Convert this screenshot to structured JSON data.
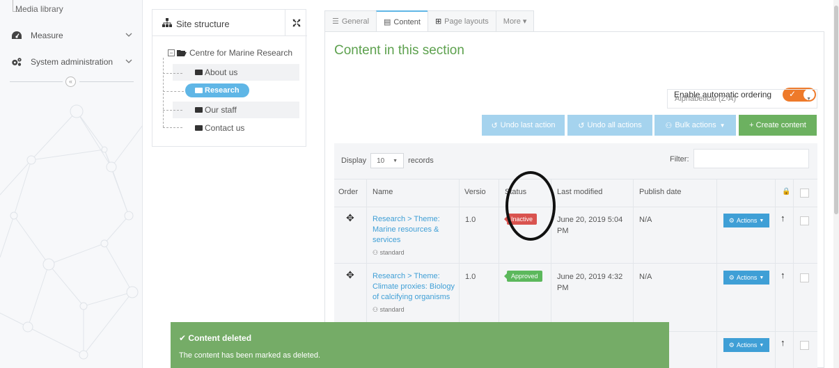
{
  "sidebar": {
    "media_library": "Media library",
    "items": [
      {
        "label": "Measure",
        "icon": "dashboard-icon"
      },
      {
        "label": "System administration",
        "icon": "gears-icon"
      }
    ],
    "collapse_glyph": "«"
  },
  "site_structure": {
    "title": "Site structure",
    "root": "Centre for Marine Research",
    "nodes": [
      "About us",
      "Research",
      "Our staff",
      "Contact us"
    ],
    "selected": "Research"
  },
  "tabs": [
    {
      "label": "General",
      "icon": "sliders-icon"
    },
    {
      "label": "Content",
      "icon": "document-icon"
    },
    {
      "label": "Page layouts",
      "icon": "layout-icon"
    },
    {
      "label": "More ▾",
      "icon": ""
    }
  ],
  "content": {
    "title": "Content in this section",
    "auto_ordering_label": "Enable automatic ordering",
    "auto_ordering_enabled": true,
    "order_select": "Alphabetical (Z-A)",
    "buttons": {
      "undo_last": "Undo last action",
      "undo_all": "Undo all actions",
      "bulk": "Bulk actions",
      "create": "+ Create content"
    },
    "display_label": "Display",
    "display_value": "10",
    "records_label": "records",
    "filter_label": "Filter:",
    "filter_value": "",
    "columns": [
      "Order",
      "Name",
      "Versio",
      "Status",
      "Last modified",
      "Publish date"
    ],
    "rows": [
      {
        "name": "Research > Theme: Marine resources & services",
        "type": "standard",
        "version": "1.0",
        "status": "Inactive",
        "last_modified": "June 20, 2019 5:04 PM",
        "publish_date": "N/A",
        "actions": "Actions"
      },
      {
        "name": "Research > Theme: Climate proxies: Biology of calcifying organisms",
        "type": "standard",
        "version": "1.0",
        "status": "Approved",
        "last_modified": "June 20, 2019 4:32 PM",
        "publish_date": "N/A",
        "actions": "Actions"
      },
      {
        "actions": "Actions"
      }
    ]
  },
  "toast": {
    "title": "Content deleted",
    "message": "The content has been marked as deleted."
  },
  "colors": {
    "accent_blue": "#5fb6e6",
    "title_green": "#5da14e",
    "toggle_orange": "#ee7a2a",
    "status_inactive": "#d9534f",
    "status_approved": "#5cb85c",
    "toast_green": "#75ac67"
  }
}
